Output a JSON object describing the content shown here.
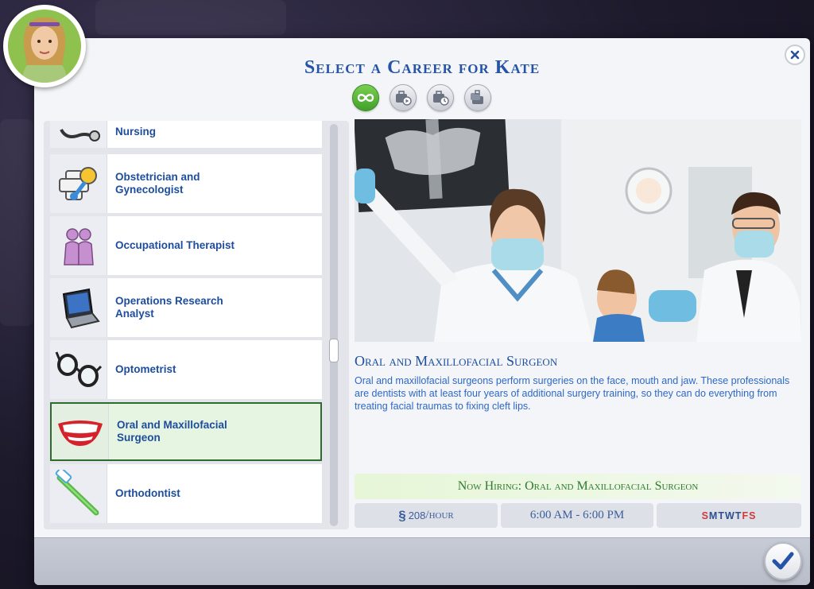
{
  "dialog": {
    "title": "Select a Career for Kate",
    "close_icon": "close-icon",
    "confirm_icon": "checkmark-icon"
  },
  "filters": [
    {
      "name": "all-careers-icon",
      "active": true
    },
    {
      "name": "active-career-icon",
      "active": false
    },
    {
      "name": "part-time-icon",
      "active": false
    },
    {
      "name": "freelance-icon",
      "active": false
    }
  ],
  "careers": [
    {
      "label": "Nursing",
      "icon": "stethoscope-icon"
    },
    {
      "label": "Obstetrician and\nGynecologist",
      "icon": "baby-rattle-icon"
    },
    {
      "label": "Occupational Therapist",
      "icon": "people-icon"
    },
    {
      "label": "Operations Research\nAnalyst",
      "icon": "laptop-icon"
    },
    {
      "label": "Optometrist",
      "icon": "glasses-icon"
    },
    {
      "label": "Oral and Maxillofacial\nSurgeon",
      "icon": "smile-icon",
      "selected": true
    },
    {
      "label": "Orthodontist",
      "icon": "toothbrush-icon"
    }
  ],
  "detail": {
    "title": "Oral and Maxillofacial Surgeon",
    "description": "Oral and maxillofacial surgeons perform surgeries on the face, mouth and jaw. These professionals are dentists with at least four years of additional surgery training, so they can do everything from treating facial traumas to fixing cleft lips.",
    "hiring": "Now Hiring: Oral and Maxillofacial Surgeon",
    "pay_symbol": "§",
    "pay": "208",
    "pay_unit": "/hour",
    "hours": "6:00 AM - 6:00 PM",
    "days": [
      "S",
      "M",
      "T",
      "W",
      "T",
      "F",
      "S"
    ]
  },
  "colors": {
    "title_blue": "#2453a8",
    "work_day": "#2f4f8f",
    "off_day": "#d23a3a",
    "hiring_green": "#2f7a2f"
  }
}
